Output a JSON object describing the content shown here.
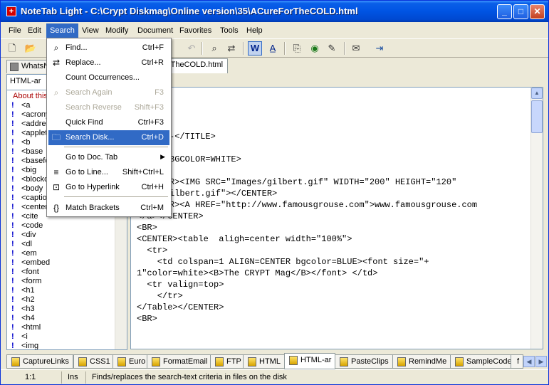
{
  "window": {
    "title": "NoteTab Light  -  C:\\Crypt Diskmag\\Online version\\35\\ACureForTheCOLD.html",
    "app_icon": "+",
    "min_glyph": "_",
    "max_glyph": "□",
    "close_glyph": "✕"
  },
  "menu": [
    "File",
    "Edit",
    "Search",
    "View",
    "Modify",
    "Document",
    "Favorites",
    "Tools",
    "Help"
  ],
  "toolbar_icons": [
    "new-file-icon",
    "open-folder-icon",
    "save-icon",
    "undo-icon",
    "binoculars-find-icon",
    "find-replace-icon",
    "word-wrap-icon",
    "text-case-icon",
    "copy-icon",
    "preview-icon",
    "clip-icon",
    "chat-icon",
    "exit-icon"
  ],
  "doc_tabs": [
    {
      "label": "WhatsN"
    },
    {
      "label": "rTheCOLD.html"
    }
  ],
  "left_panel": {
    "library": "HTML-ar",
    "group": "About this",
    "items": [
      "<a",
      "<acrony",
      "<addres",
      "<applet",
      "<b",
      "<base",
      "<basefo",
      "<big",
      "<blockq",
      "<body",
      "<captio",
      "<center",
      "<cite",
      "<code",
      "<div",
      "<dl",
      "<em",
      "<embed",
      "<font",
      "<form",
      "<h1",
      "<h2",
      "<h3",
      "<h4",
      "<html",
      "<i",
      "<img"
    ]
  },
  "code_lines": [
    "-</TITLE>",
    "BGCOLOR=WHITE>",
    "R><IMG SRC=\"Images/gilbert.gif\" WIDTH=\"200\" HEIGHT=\"120\"",
    "ilbert.gif\"></CENTER>",
    "R><A HREF=\"http://www.famousgrouse.com\">www.famousgrouse.com",
    "</a></CENTER>",
    "<BR>",
    "<CENTER><table  aligh=center width=\"100%\">",
    "  <tr>",
    "    <td colspan=1 ALIGN=CENTER bgcolor=BLUE><font size=\"+",
    "1\"color=white><B>The CRYPT Mag</B></font> </td>",
    "  <tr valign=top>",
    "    </tr>",
    "</Table></CENTER>",
    "<BR>"
  ],
  "search_menu": [
    {
      "label": "Find...",
      "shortcut": "Ctrl+F",
      "icon": "binoculars-icon",
      "state": "normal"
    },
    {
      "label": "Replace...",
      "shortcut": "Ctrl+R",
      "icon": "replace-icon",
      "state": "normal"
    },
    {
      "label": "Count Occurrences...",
      "shortcut": "",
      "icon": "",
      "state": "normal"
    },
    {
      "label": "Search Again",
      "shortcut": "F3",
      "icon": "search-again-icon",
      "state": "disabled"
    },
    {
      "label": "Search Reverse",
      "shortcut": "Shift+F3",
      "icon": "",
      "state": "disabled"
    },
    {
      "label": "Quick Find",
      "shortcut": "Ctrl+F3",
      "icon": "",
      "state": "normal"
    },
    {
      "label": "Search Disk...",
      "shortcut": "Ctrl+D",
      "icon": "search-disk-icon",
      "state": "hover"
    },
    {
      "label": "Go to Doc. Tab",
      "shortcut": "",
      "icon": "",
      "state": "normal",
      "submenu": true
    },
    {
      "label": "Go to Line...",
      "shortcut": "Shift+Ctrl+L",
      "icon": "goto-line-icon",
      "state": "normal"
    },
    {
      "label": "Go to Hyperlink",
      "shortcut": "Ctrl+H",
      "icon": "hyperlink-icon",
      "state": "normal"
    },
    {
      "label": "Match Brackets",
      "shortcut": "Ctrl+M",
      "icon": "brackets-icon",
      "state": "normal"
    }
  ],
  "bottom_tabs": [
    "CaptureLinks",
    "CSS1",
    "Euro",
    "FormatEmail",
    "FTP",
    "HTML",
    "HTML-ar",
    "PasteClips",
    "RemindMe",
    "SampleCode",
    "f"
  ],
  "status": {
    "position": "1:1",
    "mode": "Ins",
    "message": "Finds/replaces the search-text criteria in files on the disk"
  }
}
